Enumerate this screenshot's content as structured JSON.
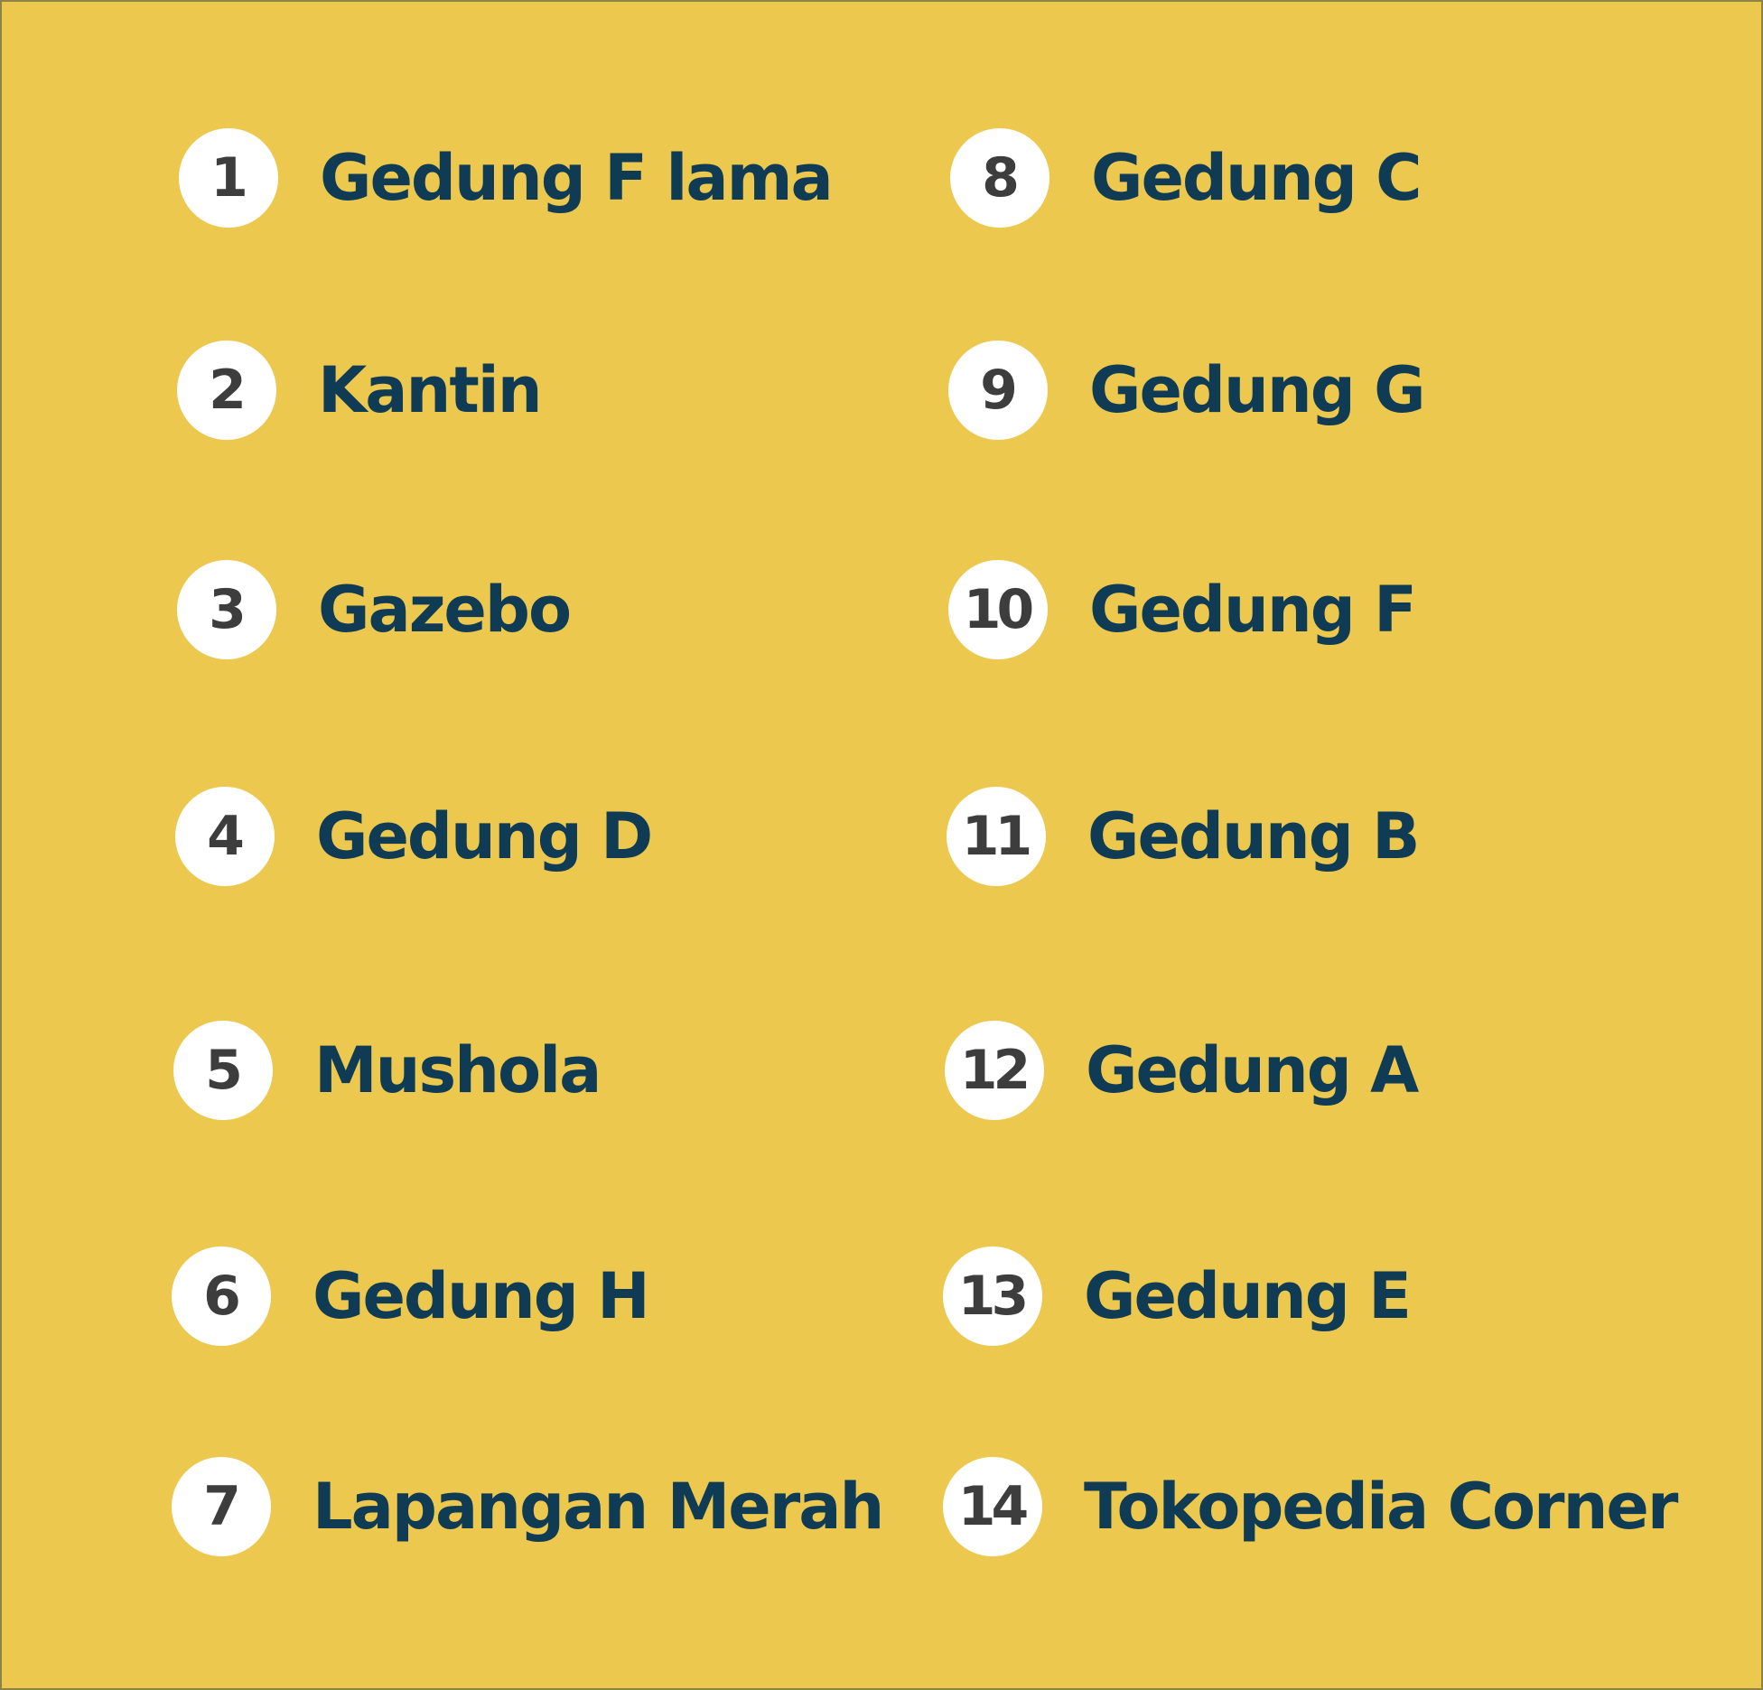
{
  "colors": {
    "background": "#ecc84f",
    "badge": "#ffffff",
    "number": "#3d3d3d",
    "label": "#0f3b54",
    "border": "#8e8346"
  },
  "legend": {
    "left_column": [
      {
        "number": "1",
        "label": "Gedung F lama"
      },
      {
        "number": "2",
        "label": "Kantin"
      },
      {
        "number": "3",
        "label": "Gazebo"
      },
      {
        "number": "4",
        "label": "Gedung D"
      },
      {
        "number": "5",
        "label": "Mushola"
      },
      {
        "number": "6",
        "label": "Gedung H"
      },
      {
        "number": "7",
        "label": "Lapangan Merah"
      }
    ],
    "right_column": [
      {
        "number": "8",
        "label": "Gedung C"
      },
      {
        "number": "9",
        "label": "Gedung G"
      },
      {
        "number": "10",
        "label": "Gedung F"
      },
      {
        "number": "11",
        "label": "Gedung B"
      },
      {
        "number": "12",
        "label": "Gedung A"
      },
      {
        "number": "13",
        "label": "Gedung E"
      },
      {
        "number": "14",
        "label": "Tokopedia Corner"
      }
    ]
  }
}
